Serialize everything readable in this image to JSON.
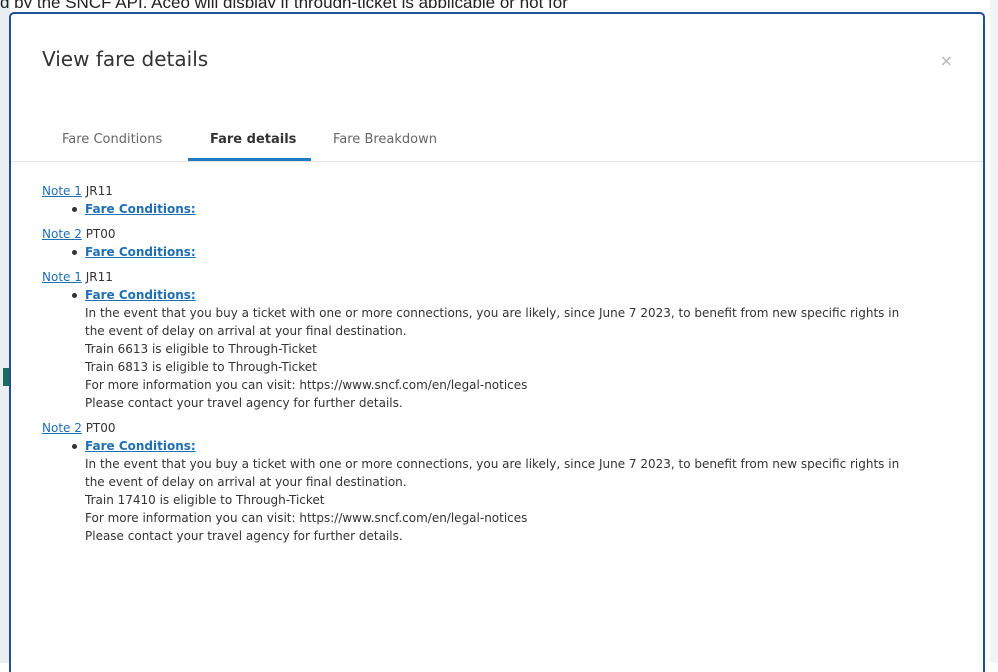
{
  "background": {
    "top_text": "d by the SNCF API, Aceo will display if through-ticket is applicable or not for"
  },
  "modal": {
    "title": "View fare details",
    "close_glyph": "×",
    "tabs": [
      {
        "label": "Fare Conditions"
      },
      {
        "label": "Fare details"
      },
      {
        "label": "Fare Breakdown"
      }
    ],
    "active_tab": "Fare details"
  },
  "notes": [
    {
      "link": "Note 1",
      "code": "JR11",
      "fc_label": "Fare Conditions:",
      "lines": []
    },
    {
      "link": "Note 2",
      "code": "PT00",
      "fc_label": "Fare Conditions:",
      "lines": []
    },
    {
      "link": "Note 1",
      "code": "JR11",
      "fc_label": "Fare Conditions:",
      "lines": [
        "In the event that you buy a ticket with one or more connections, you are likely, since June 7 2023, to benefit from new specific rights in",
        "the event of delay on arrival at your final destination.",
        "Train 6613 is eligible to Through-Ticket",
        "Train 6813 is eligible to Through-Ticket",
        "For more information you can visit: https://www.sncf.com/en/legal-notices",
        "Please contact your travel agency for further details."
      ]
    },
    {
      "link": "Note 2",
      "code": "PT00",
      "fc_label": "Fare Conditions:",
      "lines": [
        "In the event that you buy a ticket with one or more connections, you are likely, since June 7 2023, to benefit from new specific rights in",
        "the event of delay on arrival at your final destination.",
        "Train 17410 is eligible to Through-Ticket",
        "For more information you can visit: https://www.sncf.com/en/legal-notices",
        "Please contact your travel agency for further details."
      ]
    }
  ],
  "colors": {
    "link": "#1f6fb5",
    "tab_underline": "#1f7bc0",
    "modal_border": "#1f4f9a"
  }
}
